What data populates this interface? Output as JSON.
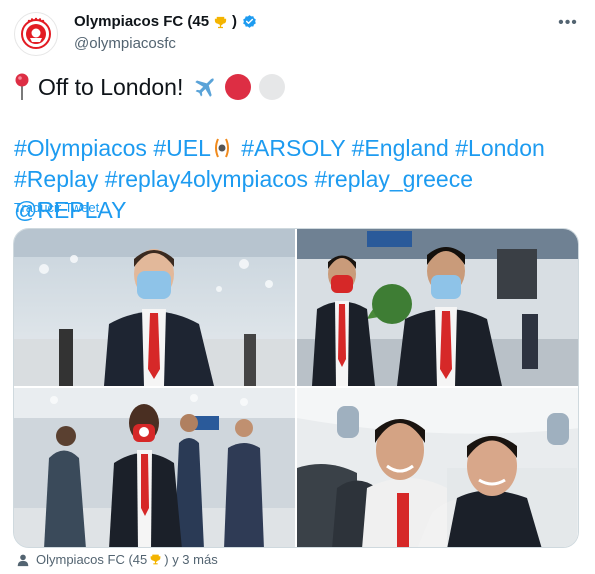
{
  "author": {
    "name": "Olympiacos FC (45",
    "trophy_icon": "trophy-icon",
    "name_suffix": ")",
    "handle": "@olympiacosfc",
    "verified_icon": "verified-badge-icon",
    "brand_color": "#e31b23"
  },
  "tweet": {
    "line1_text": "Off to London!",
    "line1_icons": [
      "round-pushpin-icon",
      "airplane-icon",
      "red-circle-icon",
      "white-circle-icon"
    ],
    "hashtags_line1": [
      "#Olympiacos",
      "#UEL",
      "#ARSOLY",
      "#England",
      "#London"
    ],
    "hashtags_line2": [
      "#Replay",
      "#replay4olympiacos",
      "#replay_greece",
      "@REPLAY"
    ],
    "translate_label": "Traducir Tweet",
    "link_color": "#1d9bf0"
  },
  "media": {
    "photos": [
      {
        "subject": "player-with-mask-airport"
      },
      {
        "subject": "two-players-airport"
      },
      {
        "subject": "player-walking-airport"
      },
      {
        "subject": "players-on-plane"
      }
    ]
  },
  "footer": {
    "tagged_text": "Olympiacos FC (45",
    "tagged_suffix": ") y 3 más",
    "tagged_icon": "person-icon"
  }
}
